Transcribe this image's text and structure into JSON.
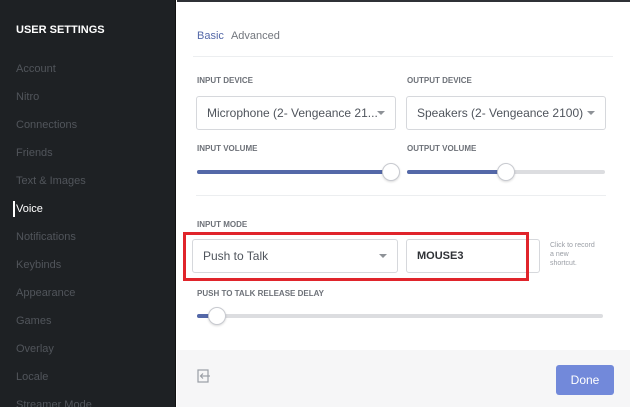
{
  "sidebar": {
    "header": "USER SETTINGS",
    "items": [
      {
        "label": "Account"
      },
      {
        "label": "Nitro"
      },
      {
        "label": "Connections"
      },
      {
        "label": "Friends"
      },
      {
        "label": "Text & Images"
      },
      {
        "label": "Voice"
      },
      {
        "label": "Notifications"
      },
      {
        "label": "Keybinds"
      },
      {
        "label": "Appearance"
      },
      {
        "label": "Games"
      },
      {
        "label": "Overlay"
      },
      {
        "label": "Locale"
      },
      {
        "label": "Streamer Mode"
      }
    ],
    "active_item": "Voice"
  },
  "tabs": [
    {
      "label": "Basic",
      "active": true
    },
    {
      "label": "Advanced",
      "active": false
    }
  ],
  "input_device": {
    "label": "INPUT DEVICE",
    "value": "Microphone (2- Vengeance 21..."
  },
  "output_device": {
    "label": "OUTPUT DEVICE",
    "value": "Speakers (2- Vengeance 2100)"
  },
  "input_volume": {
    "label": "INPUT VOLUME",
    "level": 0.98
  },
  "output_volume": {
    "label": "OUTPUT VOLUME",
    "level": 0.5
  },
  "input_mode": {
    "label": "INPUT MODE",
    "value": "Push to Talk"
  },
  "shortcut": {
    "value": "MOUSE3",
    "hint_line1": "Click to record",
    "hint_line2": "a new",
    "hint_line3": "shortcut."
  },
  "release_delay": {
    "label": "PUSH TO TALK RELEASE DELAY",
    "level": 0.05
  },
  "footer": {
    "done_label": "Done",
    "exit_icon": "exit-icon"
  },
  "colors": {
    "accent": "#5468a8",
    "button": "#7289da",
    "sidebar_bg": "#1e2124",
    "highlight": "#e0242b"
  }
}
